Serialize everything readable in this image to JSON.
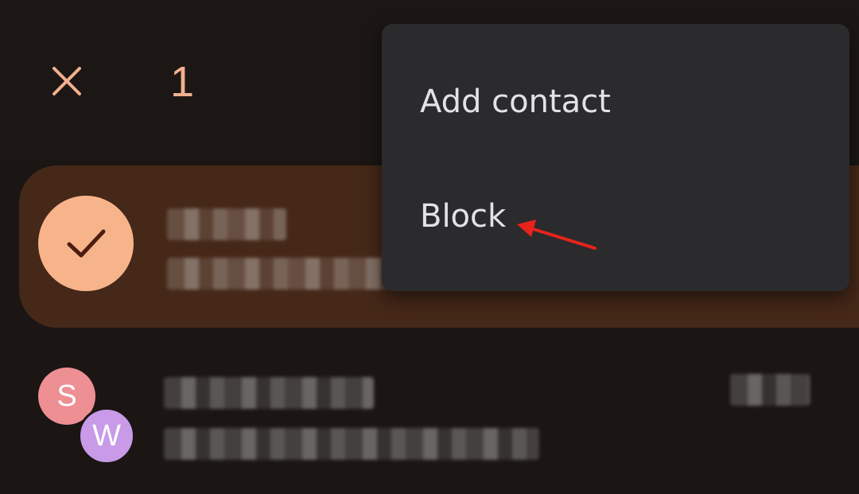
{
  "topbar": {
    "selected_count": "1"
  },
  "menu": {
    "items": [
      {
        "label": "Add contact"
      },
      {
        "label": "Block"
      }
    ]
  },
  "conversations": [
    {
      "selected": true,
      "avatar": "check-icon"
    },
    {
      "selected": false,
      "avatar_letters": [
        "S",
        "W"
      ]
    }
  ],
  "colors": {
    "accent": "#f3b08e",
    "selected_row": "#452818",
    "menu_bg": "#2b2a2c",
    "annotation_arrow": "#e8231c"
  }
}
